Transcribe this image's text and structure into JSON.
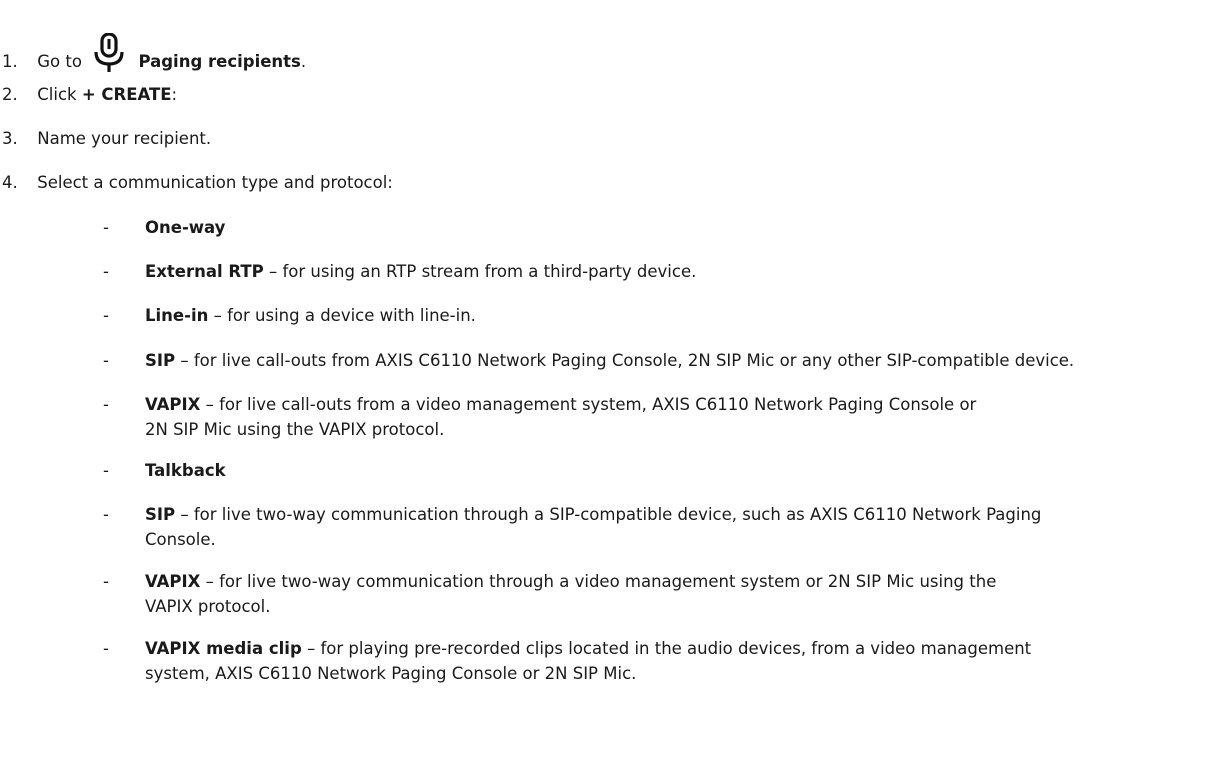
{
  "steps": [
    {
      "num": "1.",
      "pre": "Go to",
      "bold": "Paging recipients",
      "post": ".",
      "icon": "microphone-icon"
    },
    {
      "num": "2.",
      "pre": "Click",
      "bold": "+ CREATE",
      "post": ":"
    },
    {
      "num": "3.",
      "text": "Name your recipient."
    },
    {
      "num": "4.",
      "text": "Select a communication type and protocol:"
    }
  ],
  "bullets": [
    {
      "dash": "-",
      "bold": "One-way",
      "rest": ""
    },
    {
      "dash": "-",
      "bold": "External RTP",
      "rest": " – for using an RTP stream from a third-party device."
    },
    {
      "dash": "-",
      "bold": "Line-in",
      "rest": " – for using a device with line-in."
    },
    {
      "dash": "-",
      "bold": "SIP",
      "rest": " – for live call-outs from AXIS C6110 Network Paging Console, 2N SIP Mic or any other SIP-compatible device."
    },
    {
      "dash": "-",
      "bold": "VAPIX",
      "rest": " – for live call-outs from a video management system, AXIS C6110 Network Paging Console or",
      "line2": "2N SIP Mic using the VAPIX protocol."
    },
    {
      "dash": "-",
      "bold": "Talkback",
      "rest": ""
    },
    {
      "dash": "-",
      "bold": "SIP",
      "rest": " – for live two-way communication through a SIP-compatible device, such as AXIS C6110 Network Paging",
      "line2": "Console."
    },
    {
      "dash": "-",
      "bold": "VAPIX",
      "rest": " – for live two-way communication through a video management system or 2N SIP Mic using the",
      "line2": "VAPIX protocol."
    },
    {
      "dash": "-",
      "bold": "VAPIX media clip",
      "rest": " – for playing pre-recorded clips located in the audio devices, from a video management",
      "line2": "system, AXIS C6110 Network Paging Console or 2N SIP Mic."
    }
  ]
}
